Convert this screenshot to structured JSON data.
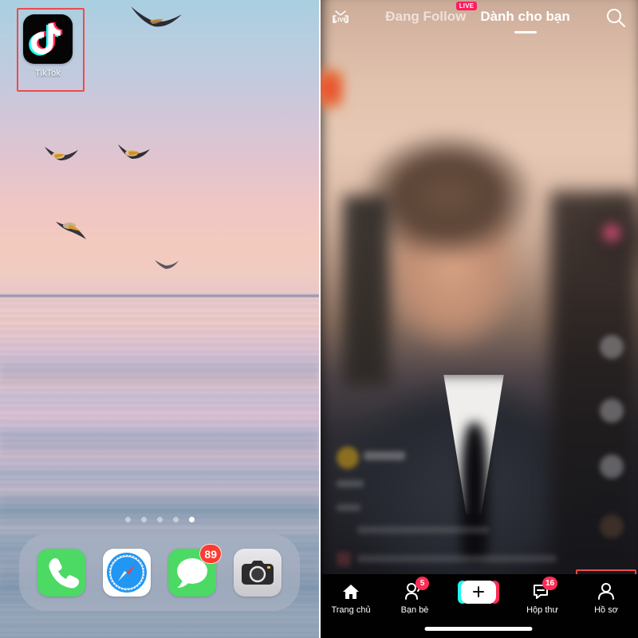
{
  "left_panel": {
    "name": "ios-home-screen",
    "app_icon": {
      "label": "TikTok",
      "icon": "tiktok-note-icon",
      "highlighted": true,
      "highlight_color": "#f04a4a"
    },
    "page_dots": {
      "count": 5,
      "active_index": 4
    },
    "dock": {
      "items": [
        {
          "label": "Phone",
          "icon": "phone-icon",
          "color": "#4cd964",
          "badge": ""
        },
        {
          "label": "Safari",
          "icon": "compass-icon",
          "color": "#ffffff",
          "badge": ""
        },
        {
          "label": "Messages",
          "icon": "message-bubble-icon",
          "color": "#4cd964",
          "badge": "89"
        },
        {
          "label": "Camera",
          "icon": "camera-icon",
          "color": "#d6d6d8",
          "badge": ""
        }
      ]
    }
  },
  "right_panel": {
    "name": "tiktok-app",
    "header": {
      "live_icon_label": "LIVE",
      "tabs": [
        {
          "label": "Đang Follow",
          "active": false,
          "badge": "LIVE"
        },
        {
          "label": "Dành cho bạn",
          "active": true,
          "badge": ""
        }
      ],
      "search_icon": "search-icon"
    },
    "bottom_nav": {
      "items": [
        {
          "label": "Trang chủ",
          "icon": "home-icon",
          "badge": "",
          "highlighted": false
        },
        {
          "label": "Bạn bè",
          "icon": "friends-icon",
          "badge": "5",
          "highlighted": false
        },
        {
          "label": "",
          "icon": "create-plus-icon",
          "badge": "",
          "highlighted": false
        },
        {
          "label": "Hộp thư",
          "icon": "inbox-message-icon",
          "badge": "16",
          "highlighted": false
        },
        {
          "label": "Hồ sơ",
          "icon": "profile-person-icon",
          "badge": "",
          "highlighted": true
        }
      ],
      "highlight_color": "#f04a4a"
    },
    "video": {
      "description": "blurred-video-person-in-suit"
    }
  },
  "colors": {
    "tiktok_cyan": "#25f4ee",
    "tiktok_pink": "#fe2c55",
    "badge_red": "#fc3b30",
    "highlight_red": "#f04a4a"
  }
}
